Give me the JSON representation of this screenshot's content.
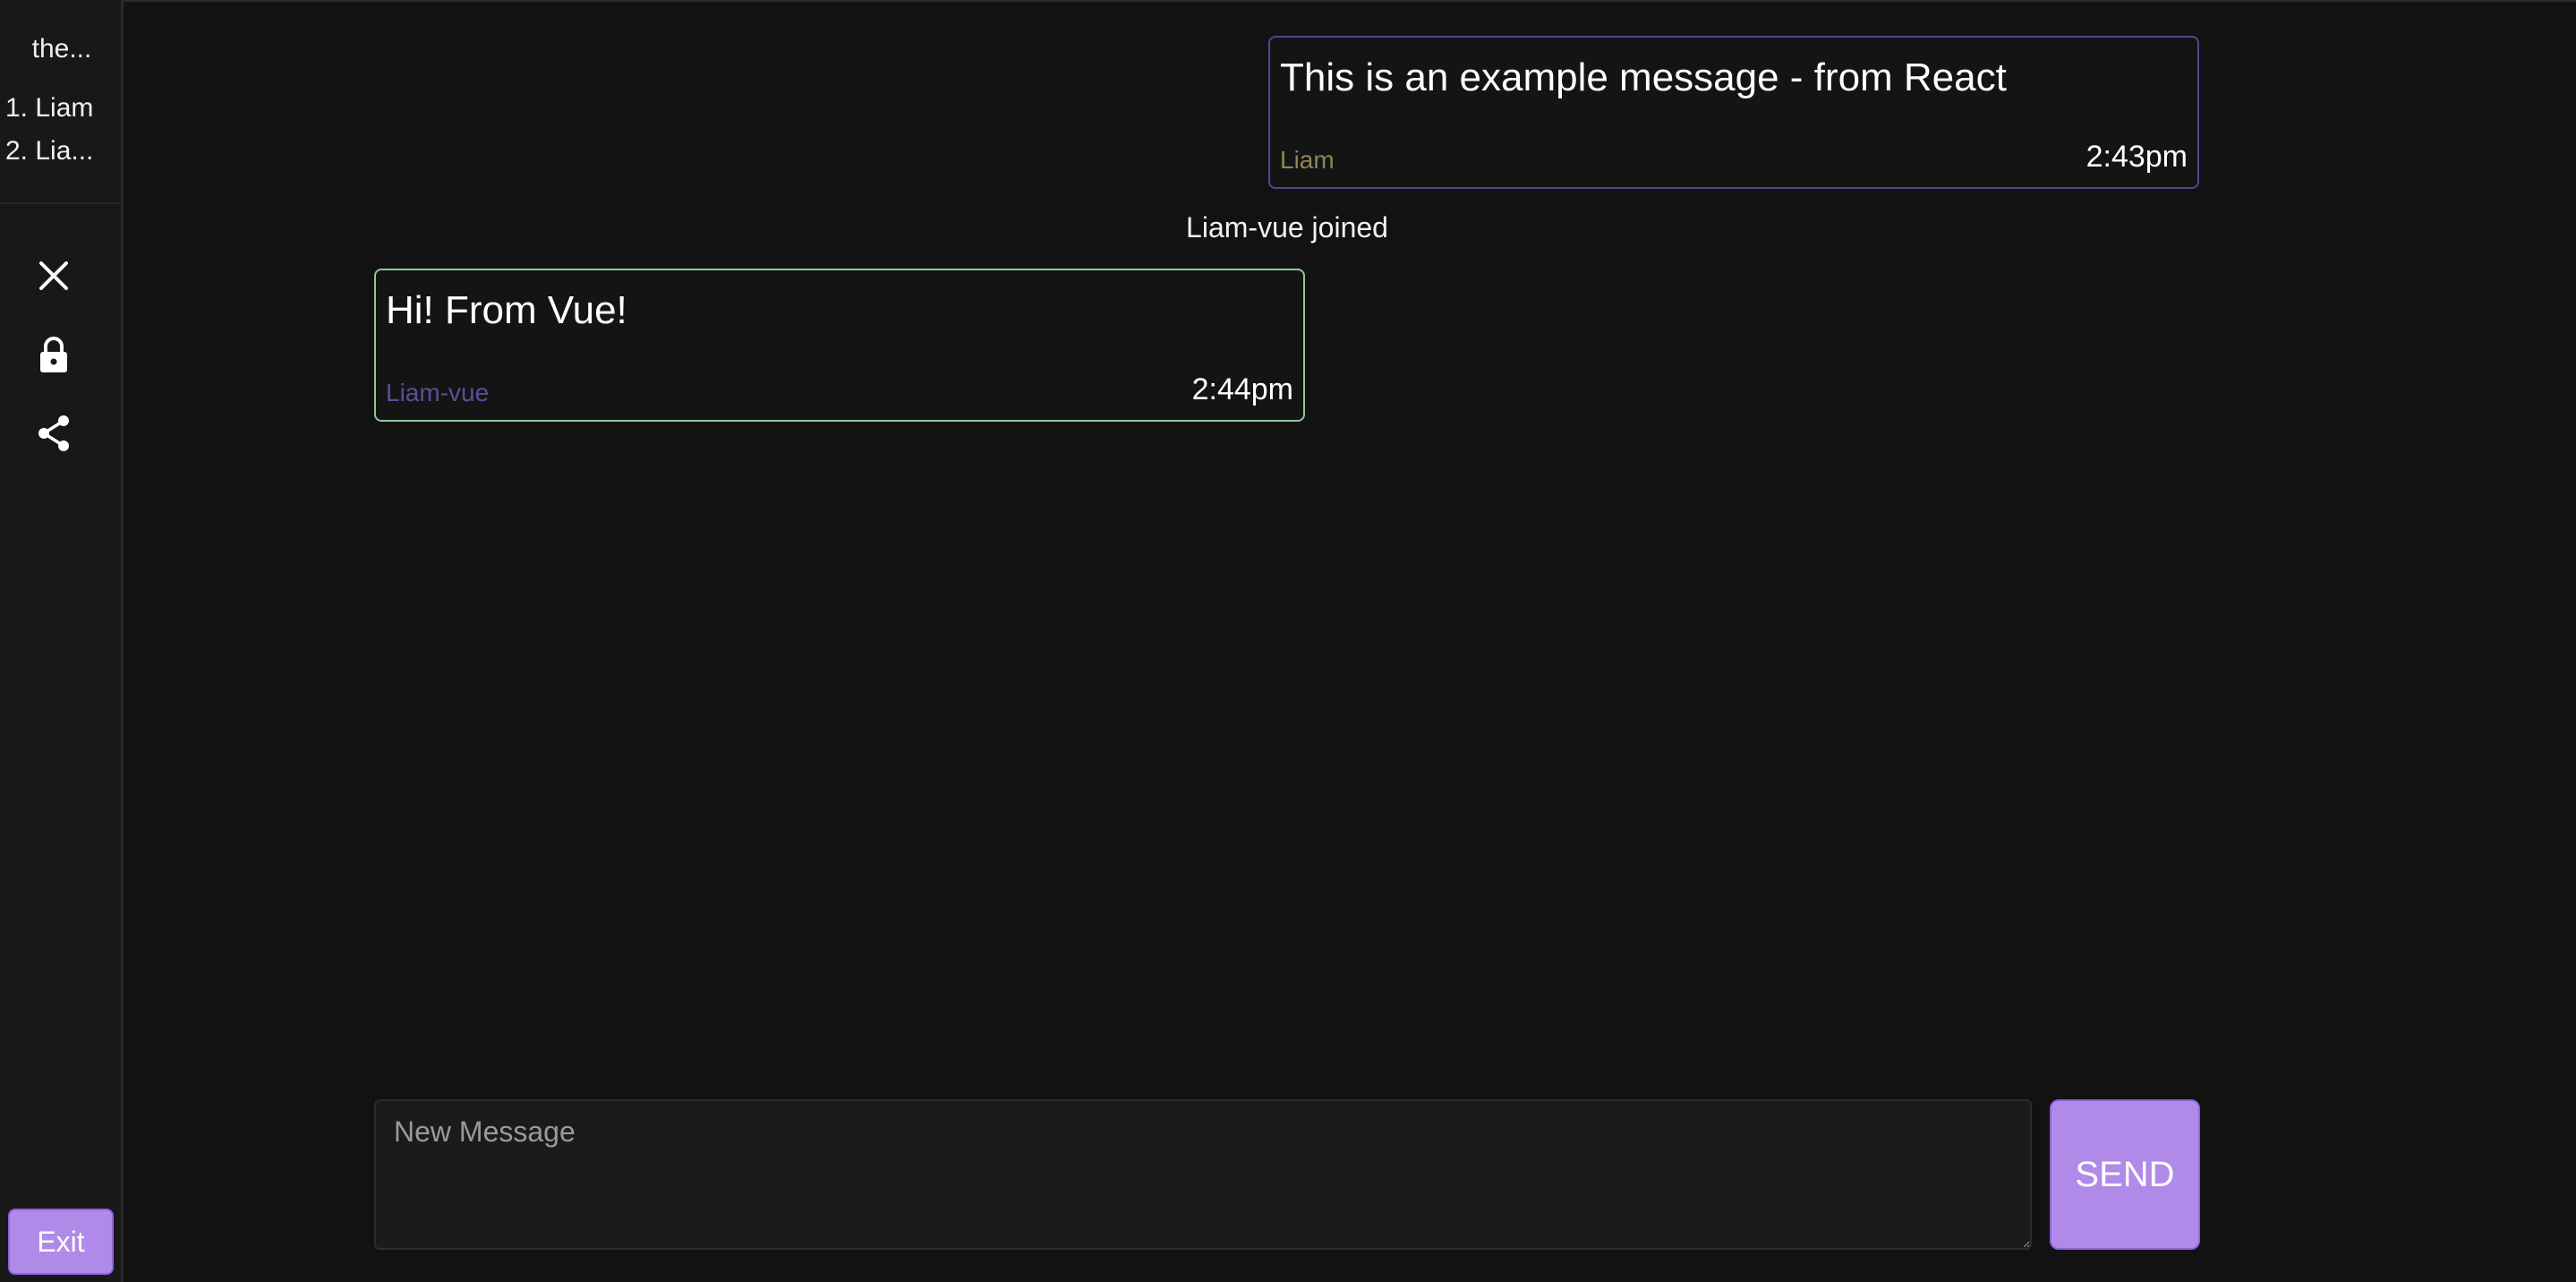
{
  "sidebar": {
    "room_name": "the...",
    "users": [
      "1. Liam",
      "2. Lia..."
    ],
    "icons": [
      "close-icon",
      "lock-icon",
      "share-icon"
    ],
    "exit_label": "Exit"
  },
  "messages": [
    {
      "text": "This is an example message - from React",
      "author": "Liam",
      "time": "2:43pm",
      "author_color": "#8f8457",
      "border_color": "#4c4a8c"
    },
    {
      "text": "Hi! From Vue!",
      "author": "Liam-vue",
      "time": "2:44pm",
      "author_color": "#5e4e96",
      "border_color": "#8fc79a"
    }
  ],
  "system": {
    "joined": "Liam-vue joined"
  },
  "composer": {
    "placeholder": "New Message",
    "value": "",
    "send_label": "SEND"
  },
  "colors": {
    "accent": "#b08ae8",
    "background": "#121212"
  }
}
